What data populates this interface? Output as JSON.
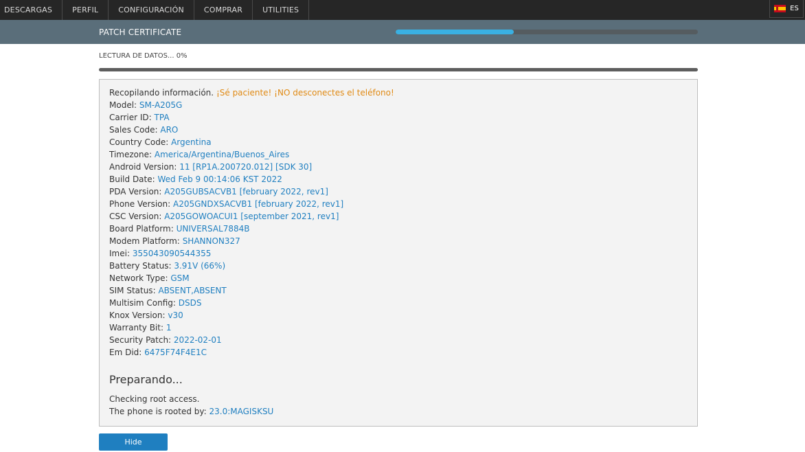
{
  "nav": {
    "items": [
      "DESCARGAS",
      "PERFIL",
      "CONFIGURACIÓN",
      "COMPRAR",
      "UTILITIES"
    ],
    "language": "ES"
  },
  "header": {
    "title": "PATCH CERTIFICATE",
    "progress": 0.39
  },
  "progress": {
    "label": "LECTURA DE DATOS... 0%",
    "value": 0
  },
  "log": {
    "intro_label": "Recopilando información.",
    "intro_warning": "¡Sé paciente! ¡NO desconectes el teléfono!",
    "fields": [
      {
        "label": "Model:",
        "value": "SM-A205G"
      },
      {
        "label": "Carrier ID:",
        "value": "TPA"
      },
      {
        "label": "Sales Code:",
        "value": "ARO"
      },
      {
        "label": "Country Code:",
        "value": "Argentina"
      },
      {
        "label": "Timezone:",
        "value": "America/Argentina/Buenos_Aires"
      },
      {
        "label": "Android Version:",
        "value": "11 [RP1A.200720.012] [SDK 30]"
      },
      {
        "label": "Build Date:",
        "value": "Wed Feb 9 00:14:06 KST 2022"
      },
      {
        "label": "PDA Version:",
        "value": "A205GUBSACVB1 [february 2022, rev1]"
      },
      {
        "label": "Phone Version:",
        "value": "A205GNDXSACVB1 [february 2022, rev1]"
      },
      {
        "label": "CSC Version:",
        "value": "A205GOWOACUI1 [september 2021, rev1]"
      },
      {
        "label": "Board Platform:",
        "value": "UNIVERSAL7884B"
      },
      {
        "label": "Modem Platform:",
        "value": "SHANNON327"
      },
      {
        "label": "Imei:",
        "value": "355043090544355"
      },
      {
        "label": "Battery Status:",
        "value": "3.91V (66%)"
      },
      {
        "label": "Network Type:",
        "value": "GSM"
      },
      {
        "label": "SIM Status:",
        "value": "ABSENT,ABSENT"
      },
      {
        "label": "Multisim Config:",
        "value": "DSDS"
      },
      {
        "label": "Knox Version:",
        "value": "v30"
      },
      {
        "label": "Warranty Bit:",
        "value": "1"
      },
      {
        "label": "Security Patch:",
        "value": "2022-02-01"
      },
      {
        "label": "Em Did:",
        "value": "6475F74F4E1C"
      }
    ],
    "section_title": "Preparando...",
    "checking": "Checking root access.",
    "rooted_label": "The phone is rooted by:",
    "rooted_value": "23.0:MAGISKSU"
  },
  "buttons": {
    "hide": "Hide"
  },
  "colors": {
    "accent": "#1f7fc0",
    "progress_fill": "#3ab0e2",
    "warning": "#e08a14",
    "topbar": "#262626",
    "band": "#5a6e7a"
  }
}
